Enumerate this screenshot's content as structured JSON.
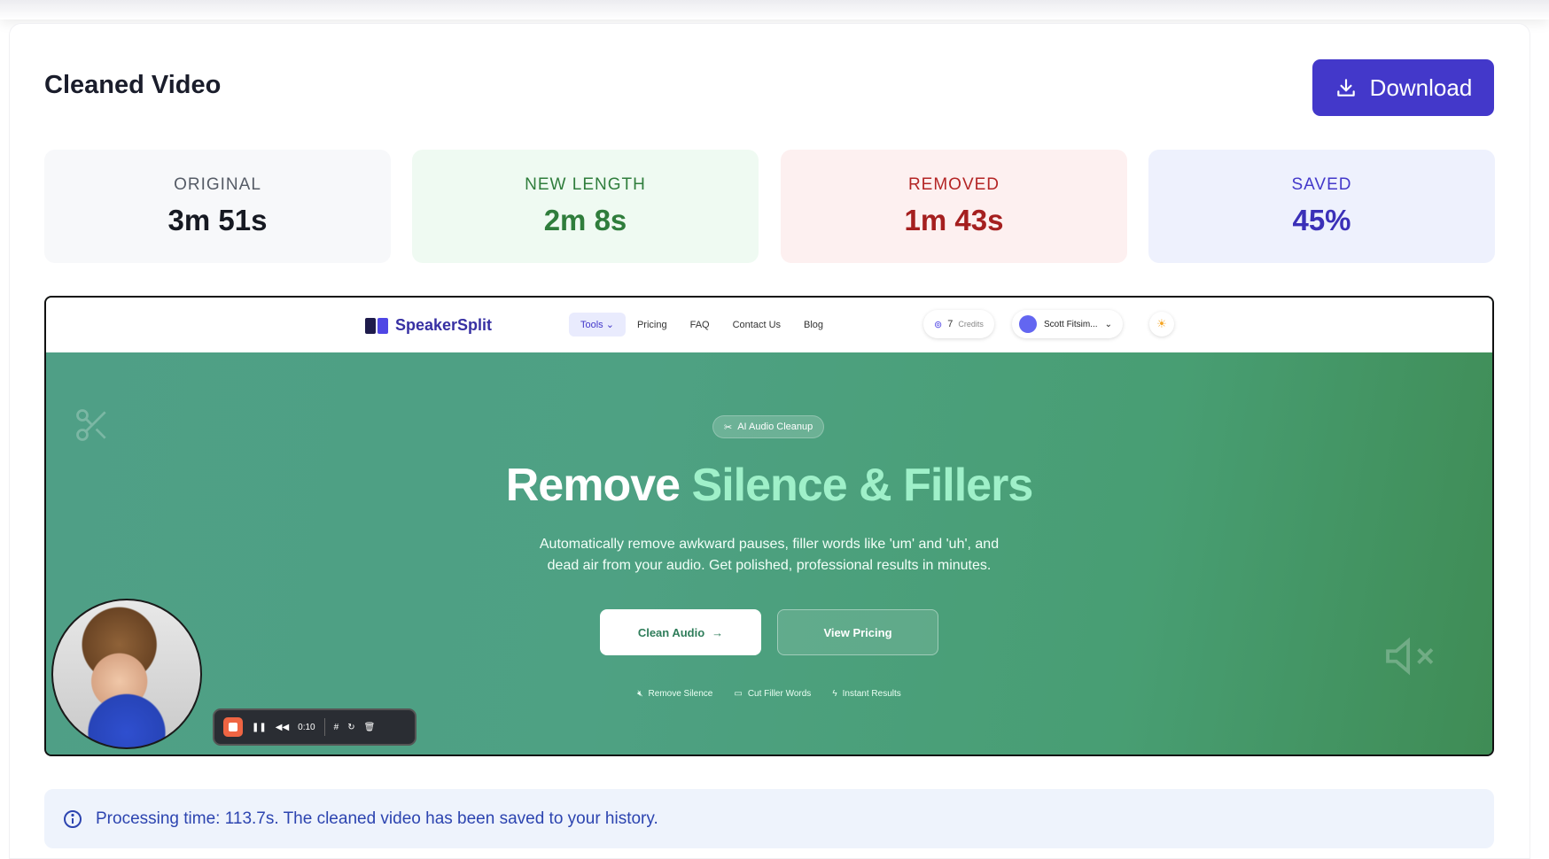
{
  "header": {
    "title": "Cleaned Video",
    "download_label": "Download"
  },
  "stats": [
    {
      "label": "ORIGINAL",
      "value": "3m 51s"
    },
    {
      "label": "NEW LENGTH",
      "value": "2m 8s"
    },
    {
      "label": "REMOVED",
      "value": "1m 43s"
    },
    {
      "label": "SAVED",
      "value": "45%"
    }
  ],
  "video": {
    "site_name": "SpeakerSplit",
    "nav": [
      "Tools",
      "Pricing",
      "FAQ",
      "Contact Us",
      "Blog"
    ],
    "credits_count": "7",
    "credits_label": "Credits",
    "user_name": "Scott Fitsim...",
    "badge": "AI Audio Cleanup",
    "headline_main": "Remove ",
    "headline_accent": "Silence & Fillers",
    "subtitle_line1": "Automatically remove awkward pauses, filler words like 'um' and 'uh', and",
    "subtitle_line2": "dead air from your audio. Get polished, professional results in minutes.",
    "cta_primary": "Clean Audio",
    "cta_secondary": "View Pricing",
    "features": [
      "Remove Silence",
      "Cut Filler Words",
      "Instant Results"
    ],
    "recorder_time": "0:10"
  },
  "info": {
    "message": "Processing time: 113.7s. The cleaned video has been saved to your history."
  },
  "colors": {
    "accent": "#4338ca",
    "hero": "#4a9a78",
    "info_bg": "#eef3fc"
  }
}
